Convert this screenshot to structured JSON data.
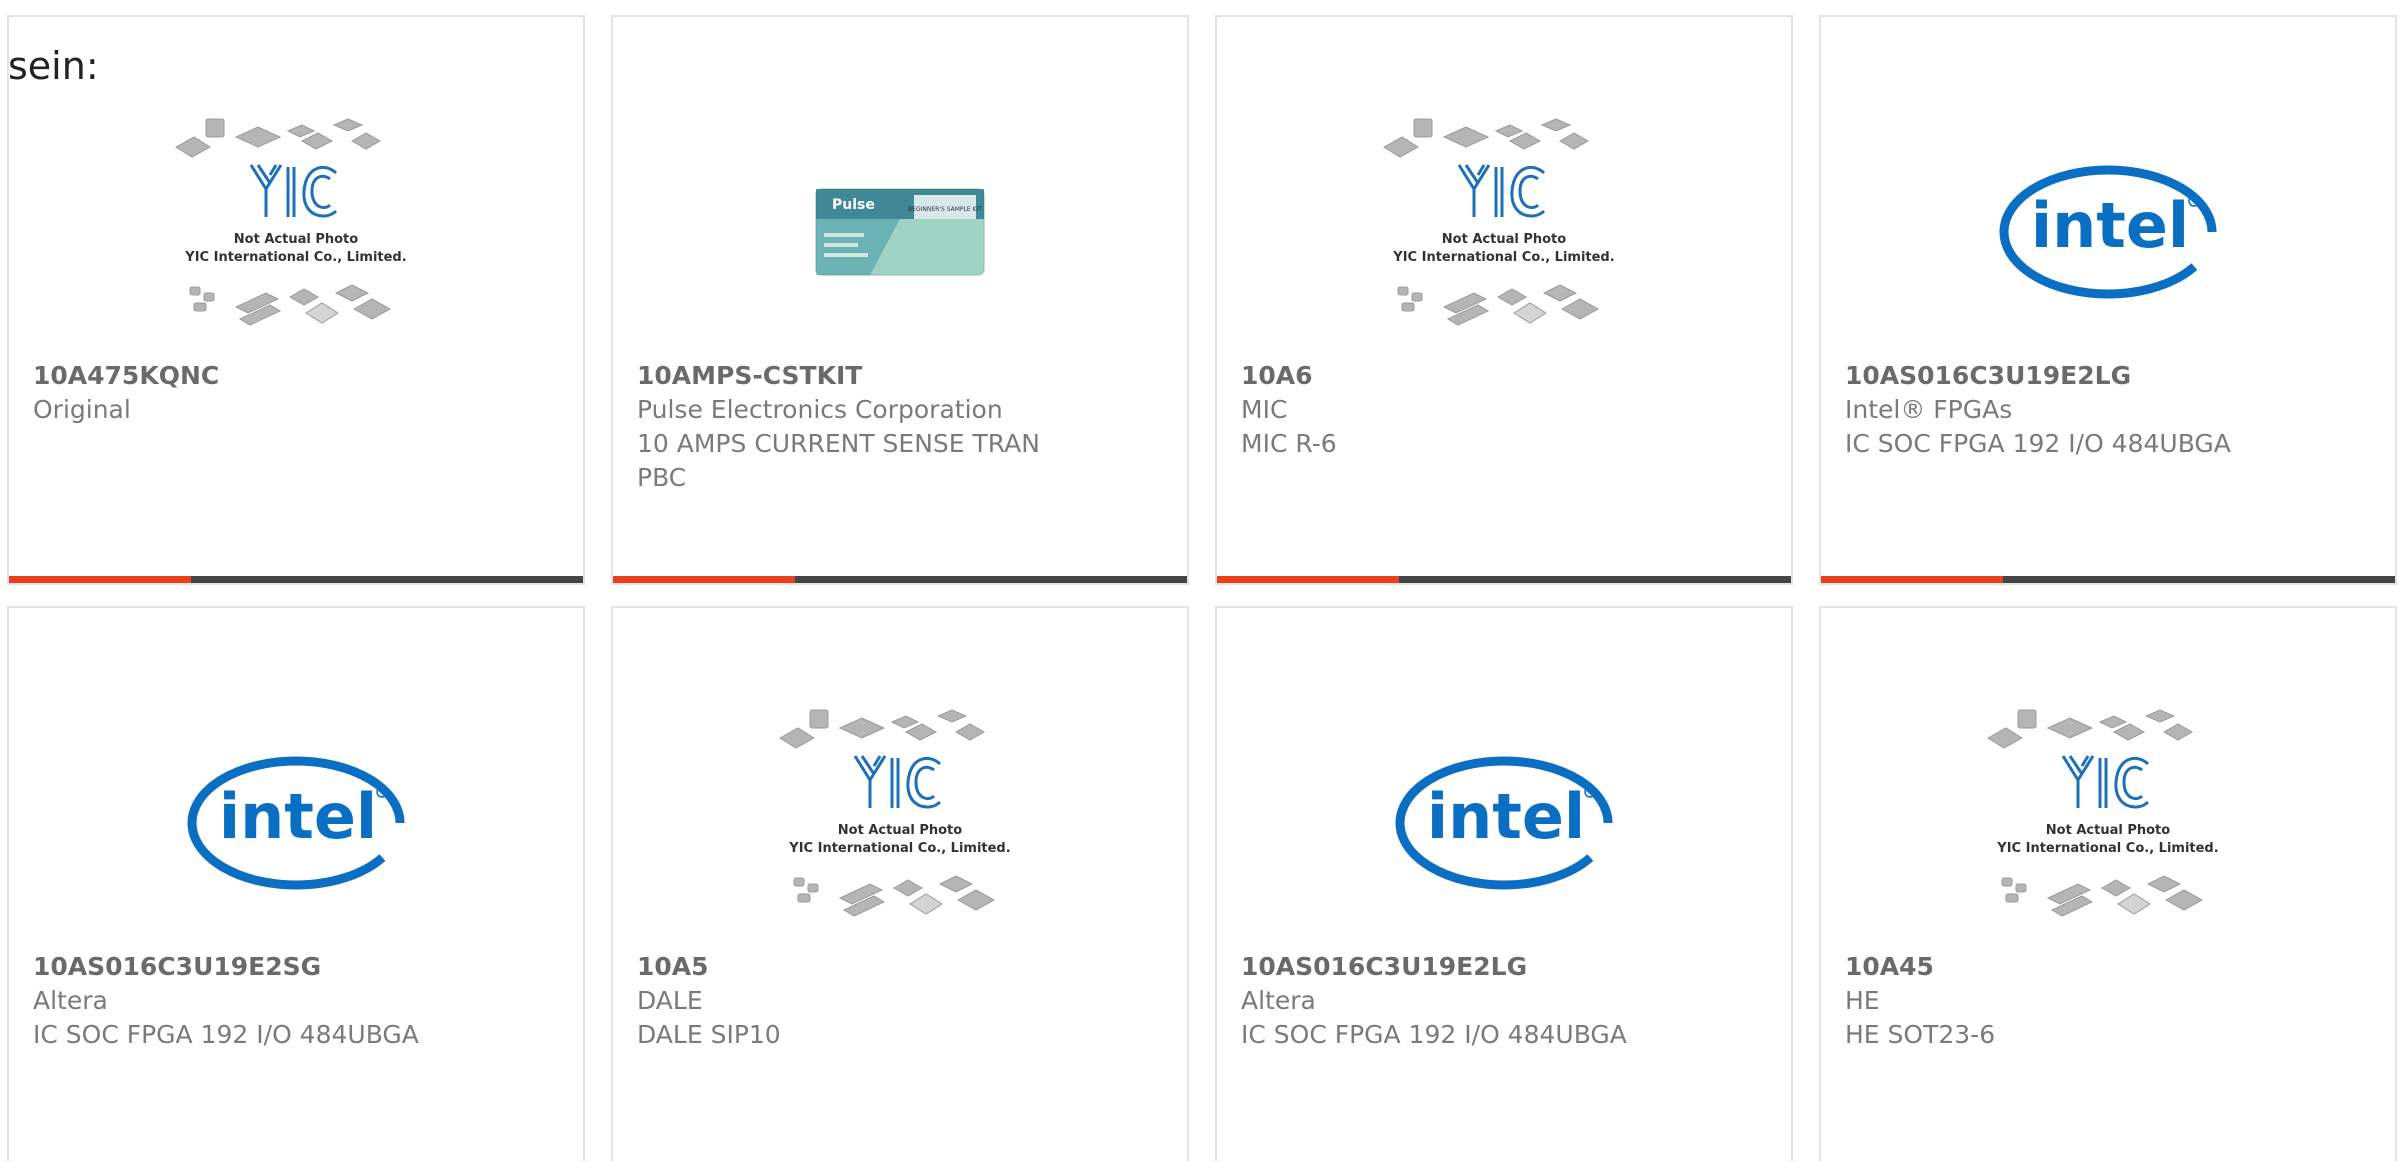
{
  "heading": "sein:",
  "placeholder": {
    "line1": "Not Actual Photo",
    "line2": "YIC International Co., Limited.",
    "mark": "YIC"
  },
  "intel_logo": "intel",
  "pulse_kit": {
    "brand": "Pulse",
    "label": "BEGINNER'S SAMPLE KIT"
  },
  "colors": {
    "accent": "#e8401c",
    "bar": "#454545",
    "intel_blue": "#0a6fc2"
  },
  "products": [
    {
      "part": "10A475KQNC",
      "lines": [
        "Original"
      ],
      "image": "yic-placeholder"
    },
    {
      "part": "10AMPS-CSTKIT",
      "lines": [
        "Pulse Electronics Corporation",
        "10 AMPS CURRENT SENSE TRAN",
        "PBC"
      ],
      "image": "pulse-kit"
    },
    {
      "part": "10A6",
      "lines": [
        "MIC",
        "MIC R-6"
      ],
      "image": "yic-placeholder"
    },
    {
      "part": "10AS016C3U19E2LG",
      "lines": [
        "Intel® FPGAs",
        "IC SOC FPGA 192 I/O 484UBGA"
      ],
      "image": "intel-logo"
    },
    {
      "part": "10AS016C3U19E2SG",
      "lines": [
        "Altera",
        "IC SOC FPGA 192 I/O 484UBGA"
      ],
      "image": "intel-logo"
    },
    {
      "part": "10A5",
      "lines": [
        "DALE",
        "DALE SIP10"
      ],
      "image": "yic-placeholder"
    },
    {
      "part": "10AS016C3U19E2LG",
      "lines": [
        "Altera",
        "IC SOC FPGA 192 I/O 484UBGA"
      ],
      "image": "intel-logo"
    },
    {
      "part": "10A45",
      "lines": [
        "HE",
        "HE SOT23-6"
      ],
      "image": "yic-placeholder"
    }
  ]
}
